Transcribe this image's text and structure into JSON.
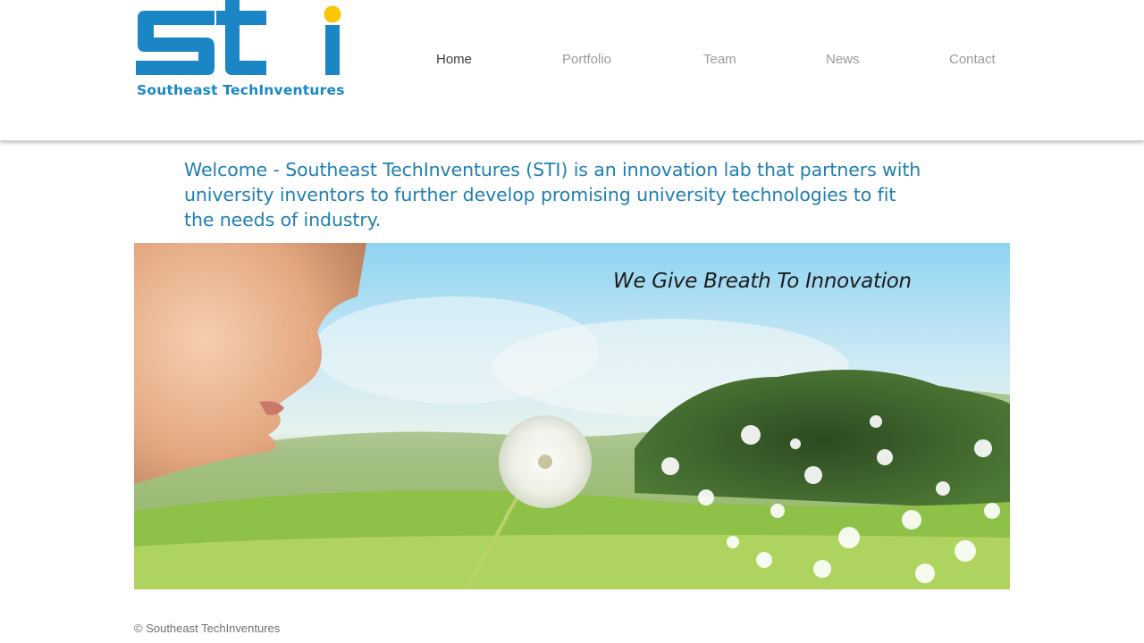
{
  "brand": {
    "logo_letters": "sti",
    "name": "Southeast TechInventures",
    "primary_color": "#1b86c6",
    "accent_color": "#f7c600"
  },
  "nav": {
    "items": [
      {
        "label": "Home",
        "active": true
      },
      {
        "label": "Portfolio",
        "active": false
      },
      {
        "label": "Team",
        "active": false
      },
      {
        "label": "News",
        "active": false
      },
      {
        "label": "Contact",
        "active": false
      }
    ]
  },
  "main": {
    "welcome_text": "Welcome - Southeast TechInventures (STI) is an innovation lab that partners with university inventors to further develop promising university technologies to fit the needs of industry.",
    "hero": {
      "tagline": "We Give Breath To Innovation",
      "image": "child-blowing-dandelion-photo"
    }
  },
  "footer": {
    "copyright": "© Southeast TechInventures"
  }
}
